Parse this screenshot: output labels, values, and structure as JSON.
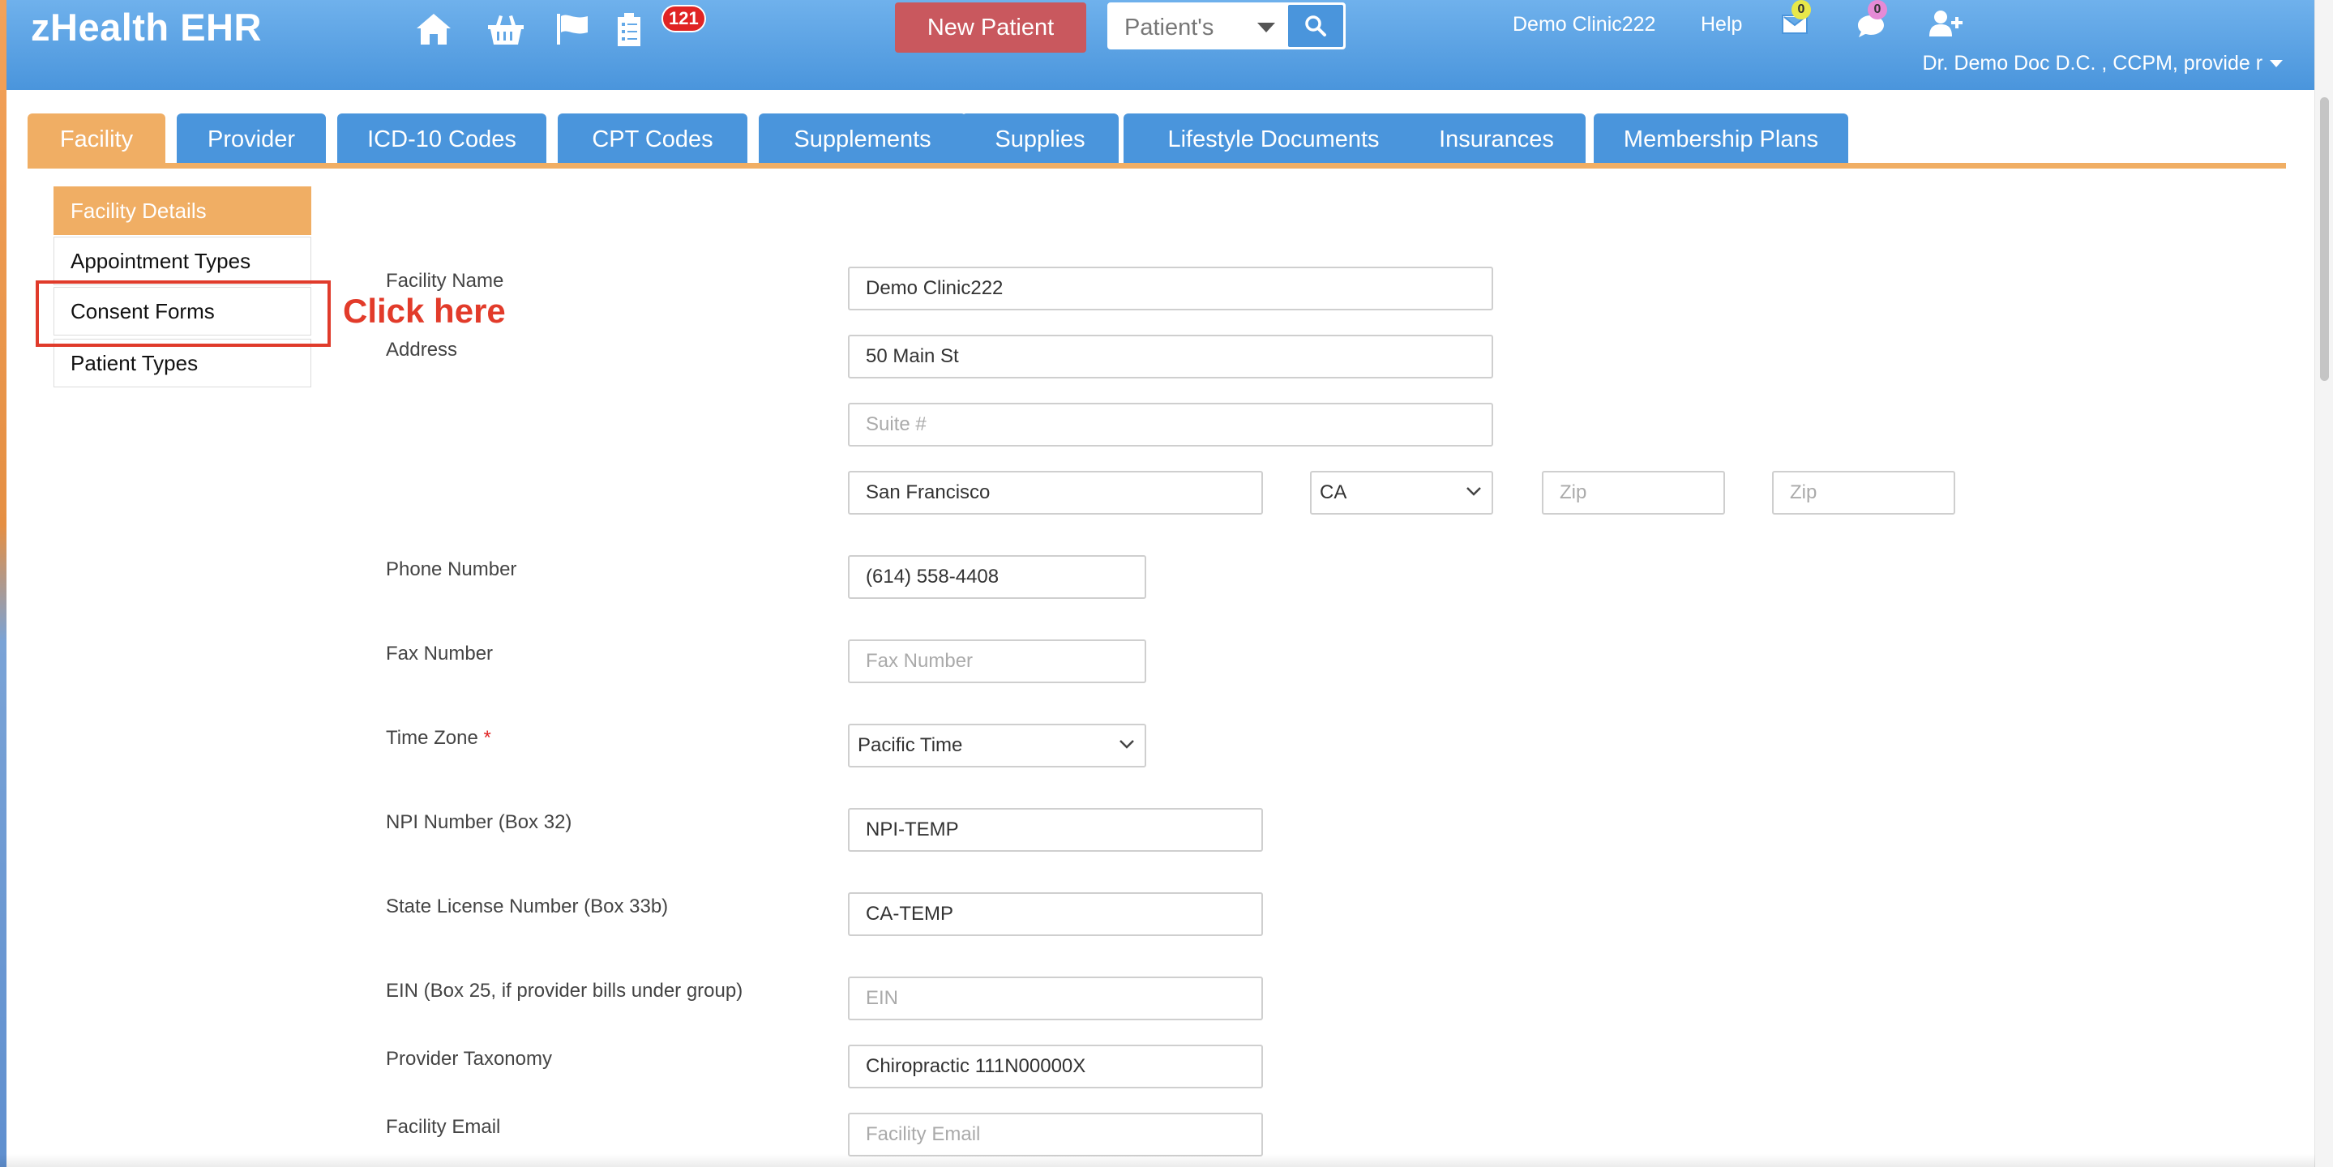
{
  "header": {
    "brand": "zHealth EHR",
    "tasks_badge": "121",
    "new_patient_label": "New Patient",
    "patient_search_selected": "Patient's",
    "clinic_name": "Demo Clinic222",
    "help_label": "Help",
    "mail_badge": "0",
    "chat_badge": "0",
    "user_label": "Dr. Demo Doc D.C. , CCPM, provide r"
  },
  "tabs": [
    {
      "label": "Facility",
      "active": true
    },
    {
      "label": "Provider"
    },
    {
      "label": "ICD-10 Codes"
    },
    {
      "label": "CPT Codes"
    },
    {
      "label": "Supplements"
    },
    {
      "label": "Supplies"
    },
    {
      "label": "Lifestyle Documents"
    },
    {
      "label": "Insurances"
    },
    {
      "label": "Membership Plans"
    }
  ],
  "submenu": [
    {
      "label": "Facility Details",
      "active": true
    },
    {
      "label": "Appointment Types"
    },
    {
      "label": "Consent Forms"
    },
    {
      "label": "Patient Types"
    }
  ],
  "callout": "Click here",
  "form": {
    "facility_name_label": "Facility Name",
    "facility_name_value": "Demo Clinic222",
    "address_label": "Address",
    "address_value": "50 Main St",
    "suite_placeholder": "Suite #",
    "city_value": "San Francisco",
    "state_value": "CA",
    "zip1_placeholder": "Zip",
    "zip2_placeholder": "Zip",
    "phone_label": "Phone Number",
    "phone_value": "(614) 558-4408",
    "fax_label": "Fax Number",
    "fax_placeholder": "Fax Number",
    "timezone_label": "Time Zone",
    "timezone_required": "*",
    "timezone_value": "Pacific Time",
    "npi_label": "NPI Number (Box 32)",
    "npi_value": "NPI-TEMP",
    "state_license_label": "State License Number (Box 33b)",
    "state_license_value": "CA-TEMP",
    "ein_label": "EIN (Box 25, if provider bills under group)",
    "ein_placeholder": "EIN",
    "taxonomy_label": "Provider Taxonomy",
    "taxonomy_value": "Chiropractic 111N00000X",
    "email_label": "Facility Email",
    "email_placeholder": "Facility Email"
  },
  "colors": {
    "header_blue": "#4a95dc",
    "tab_orange": "#f0ae64",
    "new_patient_red": "#c9585e",
    "callout_red": "#e23b2a"
  }
}
